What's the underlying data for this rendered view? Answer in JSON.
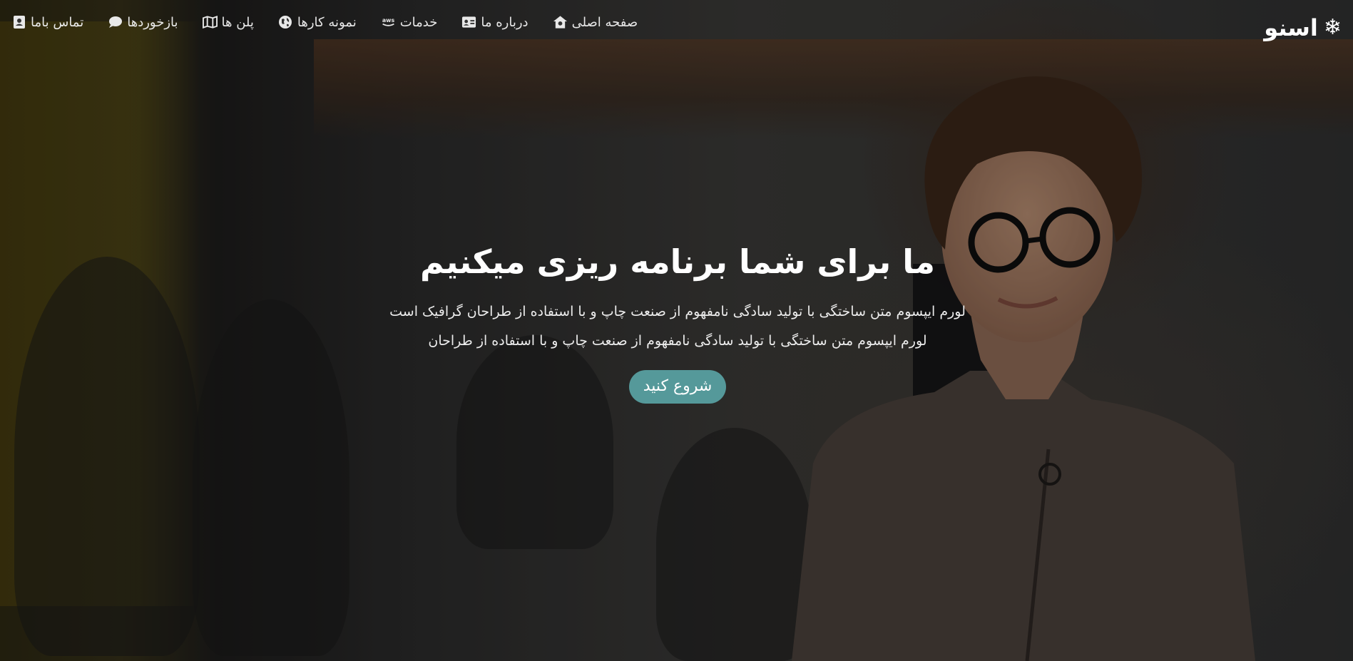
{
  "brand": {
    "name": "اسنو",
    "icon": "snowflake-icon"
  },
  "nav": {
    "items": [
      {
        "label": "صفحه اصلی",
        "icon": "home-icon"
      },
      {
        "label": "درباره ما",
        "icon": "id-card-icon"
      },
      {
        "label": "خدمات",
        "icon": "aws-icon"
      },
      {
        "label": "نمونه کارها",
        "icon": "globe-icon"
      },
      {
        "label": "پلن ها",
        "icon": "map-icon"
      },
      {
        "label": "بازخوردها",
        "icon": "comment-icon"
      },
      {
        "label": "تماس باما",
        "icon": "address-book-icon"
      }
    ]
  },
  "hero": {
    "title": "ما برای شما برنامه ریزی میکنیم",
    "line1": "لورم ایپسوم متن ساختگی با تولید سادگی نامفهوم از صنعت چاپ و با استفاده از طراحان گرافیک است",
    "line2": "لورم ایپسوم متن ساختگی با تولید سادگی نامفهوم از صنعت چاپ و با استفاده از طراحان",
    "cta_label": "شروع کنید"
  },
  "colors": {
    "accent": "#55999a",
    "overlay": "#000000"
  }
}
